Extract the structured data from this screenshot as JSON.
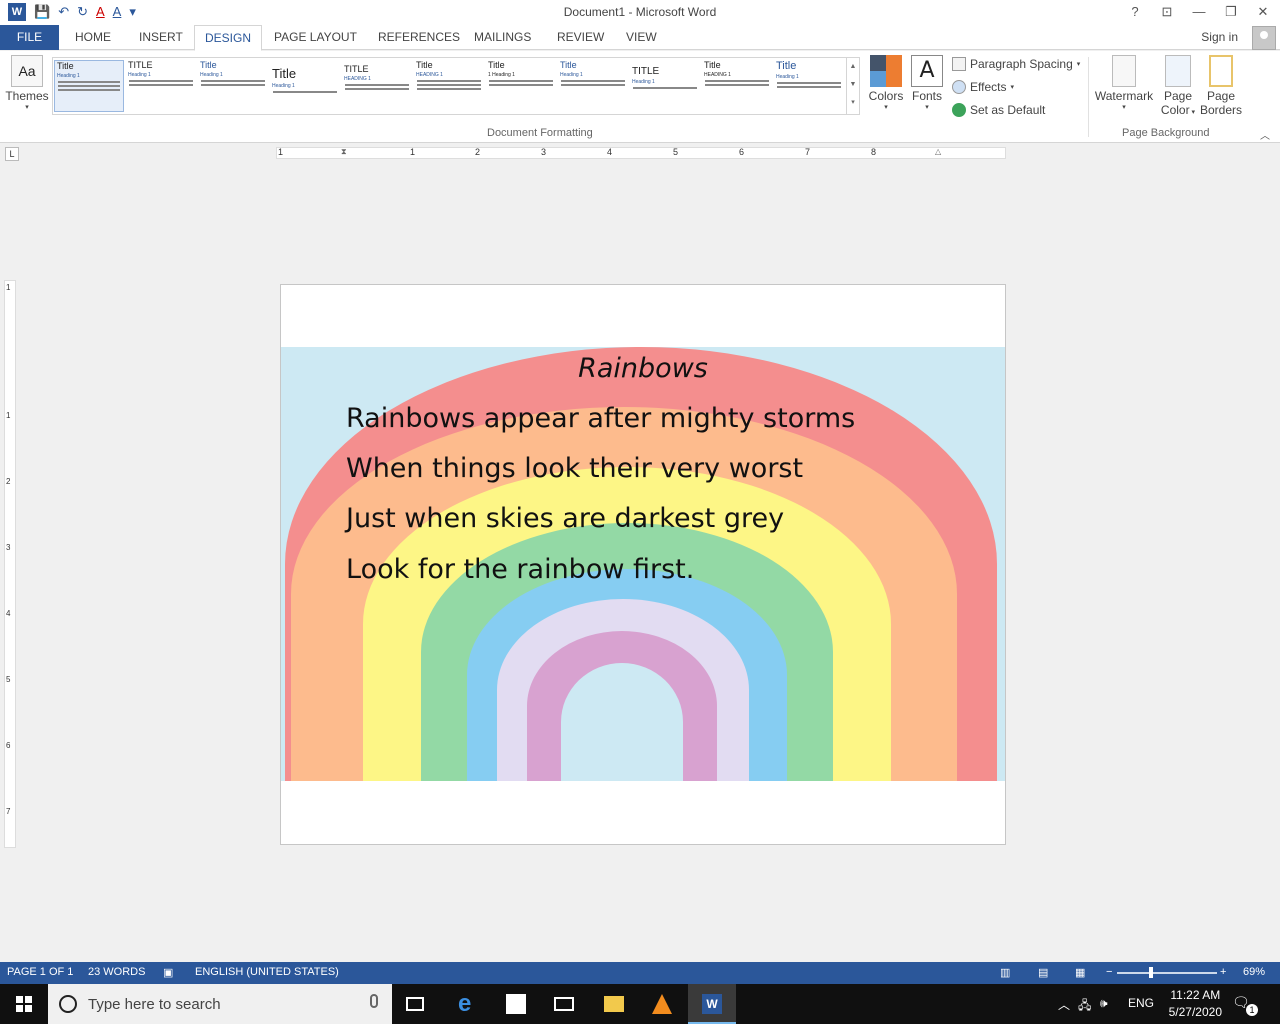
{
  "window": {
    "title": "Document1 - Microsoft Word",
    "controls": {
      "help": "?",
      "ribbon_opts": "⊡",
      "minimize": "—",
      "restore": "❐",
      "close": "✕"
    }
  },
  "qat": {
    "app_icon": "W",
    "save": "💾",
    "undo": "↶",
    "redo": "↻",
    "font_color": "A",
    "more": "▾"
  },
  "tabs": [
    "FILE",
    "HOME",
    "INSERT",
    "DESIGN",
    "PAGE LAYOUT",
    "REFERENCES",
    "MAILINGS",
    "REVIEW",
    "VIEW"
  ],
  "active_tab": "DESIGN",
  "account": {
    "sign_in": "Sign in"
  },
  "ribbon": {
    "themes_label": "Themes",
    "style_set_thumbs": [
      {
        "title": "Title",
        "heading": "Heading 1"
      },
      {
        "title": "TITLE",
        "heading": "Heading 1"
      },
      {
        "title": "Title",
        "heading": "Heading 1"
      },
      {
        "title": "Title",
        "heading": "Heading 1"
      },
      {
        "title": "TITLE",
        "heading": "HEADING 1"
      },
      {
        "title": "Title",
        "heading": "HEADING 1"
      },
      {
        "title": "Title",
        "heading": "1 Heading 1"
      },
      {
        "title": "Title",
        "heading": "Heading 1"
      },
      {
        "title": "TITLE",
        "heading": "Heading 1"
      },
      {
        "title": "Title",
        "heading": "HEADING 1"
      },
      {
        "title": "Title",
        "heading": "Heading 1"
      }
    ],
    "colors_label": "Colors",
    "fonts_label": "Fonts",
    "fonts_glyph": "A",
    "paragraph_spacing": "Paragraph Spacing",
    "effects": "Effects",
    "set_as_default": "Set as Default",
    "document_formatting": "Document Formatting",
    "watermark": "Watermark",
    "page_color_1": "Page",
    "page_color_2": "Color",
    "page_borders_1": "Page",
    "page_borders_2": "Borders",
    "page_background": "Page Background"
  },
  "ruler": {
    "tab_selector": "L",
    "h_numbers": [
      "1",
      "1",
      "2",
      "3",
      "4",
      "5",
      "6",
      "7",
      "8"
    ],
    "v_numbers": [
      "1",
      "1",
      "2",
      "3",
      "4",
      "5",
      "6",
      "7"
    ]
  },
  "document": {
    "poem_title": "Rainbows",
    "lines": [
      "Rainbows appear after mighty storms",
      "When things look their very worst",
      "Just when skies are darkest grey",
      "Look for the rainbow first."
    ],
    "colors": {
      "sky": "#cde9f3",
      "red": "#f48e8e",
      "orange": "#fdbb8d",
      "yellow": "#fdf686",
      "green": "#93d9a5",
      "blue": "#86cdf2",
      "lavender": "#e2dcf2",
      "purple": "#d8a2d0"
    }
  },
  "status": {
    "page": "PAGE 1 OF 1",
    "words": "23 WORDS",
    "language": "ENGLISH (UNITED STATES)",
    "zoom": "69%",
    "zoom_minus": "−",
    "zoom_plus": "+"
  },
  "taskbar": {
    "search_placeholder": "Type here to search",
    "icons": [
      "task-view-icon",
      "edge-icon",
      "store-icon",
      "mail-icon",
      "file-explorer-icon",
      "vlc-icon",
      "word-icon"
    ],
    "language": "ENG",
    "time": "11:22 AM",
    "date": "5/27/2020",
    "notifications": "1"
  }
}
